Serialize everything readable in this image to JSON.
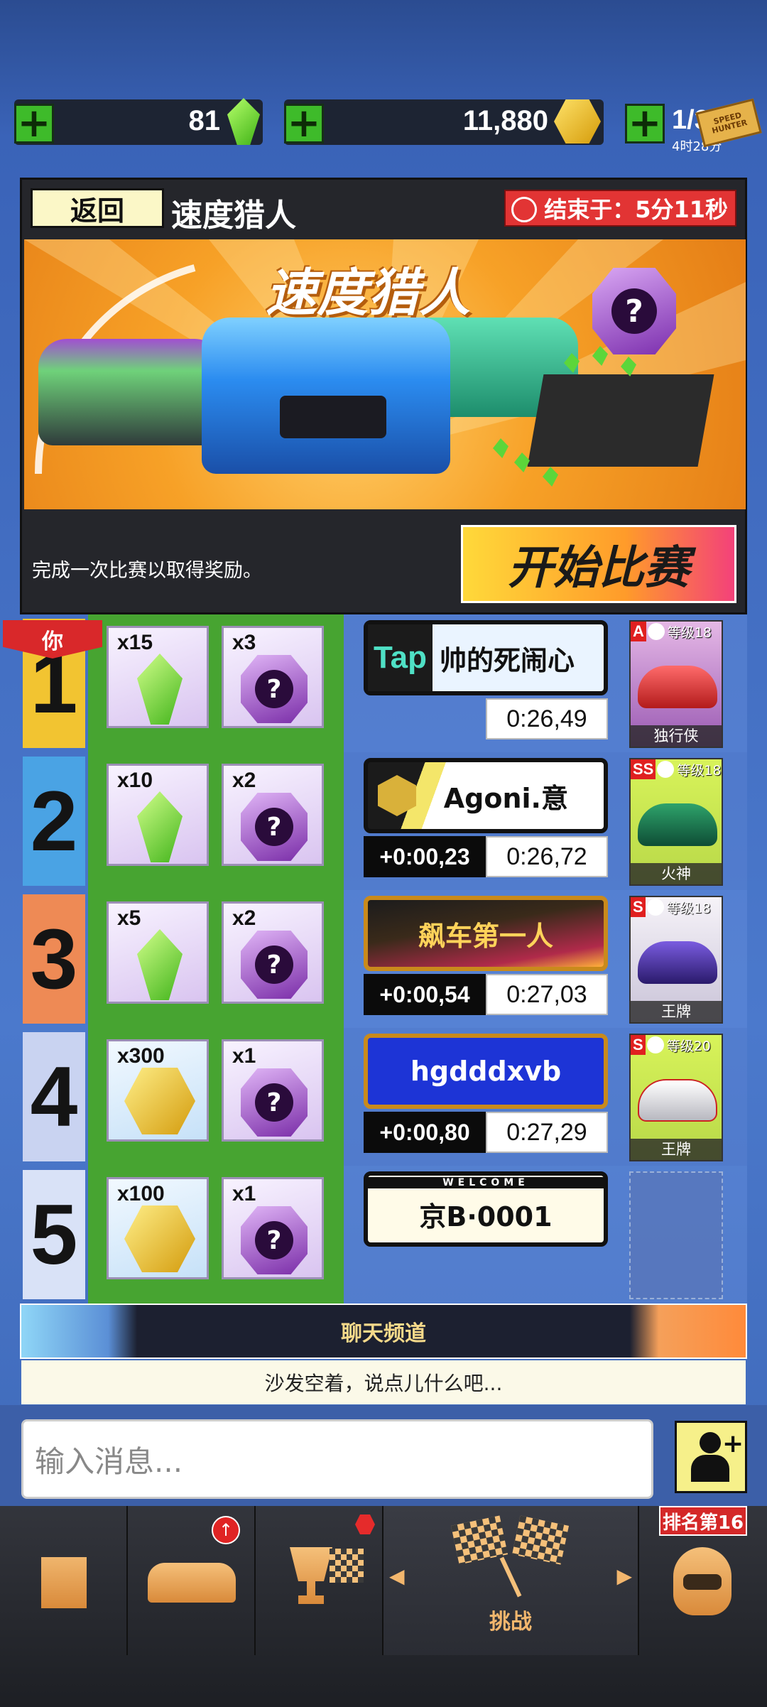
{
  "top_bar": {
    "gems": "81",
    "coins": "11,880",
    "tickets": "1/3",
    "ticket_timer": "4时28分",
    "ticket_logo": "SPEED HUNTER"
  },
  "event": {
    "back_label": "返回",
    "title": "速度猎人",
    "ends_label": "结束于：5分11秒",
    "banner_title": "速度猎人",
    "instruction": "完成一次比赛以取得奖励。",
    "start_label": "开始比赛"
  },
  "leaderboard": {
    "you_tag": "你",
    "rows": [
      {
        "rank": "1",
        "reward_primary": "x15",
        "reward_primary_type": "gem",
        "reward_mystery": "x3",
        "plate": "帅的死闹心",
        "plate_prefix": "Tap",
        "diff": "",
        "time": "0:26,49",
        "car_class": "A",
        "car_level": "等级18",
        "car_name": "独行侠",
        "rank_color": "#f2c431"
      },
      {
        "rank": "2",
        "reward_primary": "x10",
        "reward_primary_type": "gem",
        "reward_mystery": "x2",
        "plate": "Agoni.意",
        "diff": "+0:00,23",
        "time": "0:26,72",
        "car_class": "SS",
        "car_level": "等级18",
        "car_name": "火神",
        "rank_color": "#4aa3e4"
      },
      {
        "rank": "3",
        "reward_primary": "x5",
        "reward_primary_type": "gem",
        "reward_mystery": "x2",
        "plate": "飙车第一人",
        "diff": "+0:00,54",
        "time": "0:27,03",
        "car_class": "S",
        "car_level": "等级18",
        "car_name": "王牌",
        "rank_color": "#ee8a55"
      },
      {
        "rank": "4",
        "reward_primary": "x300",
        "reward_primary_type": "coin",
        "reward_mystery": "x1",
        "plate": "hgdddxvb",
        "diff": "+0:00,80",
        "time": "0:27,29",
        "car_class": "S",
        "car_level": "等级20",
        "car_name": "王牌",
        "rank_color": "#c9d3f1"
      },
      {
        "rank": "5",
        "reward_primary": "x100",
        "reward_primary_type": "coin",
        "reward_mystery": "x1",
        "plate": "京B·0001",
        "plate_welcome": "WELCOME",
        "diff": "",
        "time": "",
        "car_class": "",
        "car_level": "",
        "car_name": "",
        "rank_color": "#d9e2f7"
      }
    ]
  },
  "chat": {
    "channel_label": "聊天频道",
    "empty_message": "沙发空着，说点儿什么吧...",
    "input_placeholder": "输入消息..."
  },
  "nav": {
    "challenge_label": "挑战",
    "rank_badge": "排名第16"
  },
  "colors": {
    "accent_green": "#47a431",
    "alert_red": "#e23434",
    "start_gradient": [
      "#ffd93a",
      "#ff9b2a",
      "#f3417a"
    ]
  }
}
